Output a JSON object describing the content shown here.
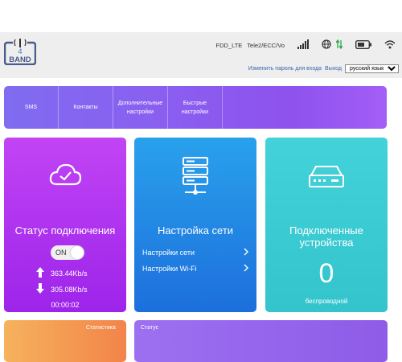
{
  "logo": {
    "text": "BAND",
    "digit": "4"
  },
  "status": {
    "network_type": "FDD_LTE",
    "operator": "Tele2/ECC/Vo",
    "icons": [
      "signal-icon",
      "globe-icon",
      "data-arrows-icon",
      "battery-icon",
      "wifi-icon"
    ]
  },
  "header_links": {
    "change_password": "Изменить пароль для входа",
    "logout": "Выход",
    "language": "русский язык"
  },
  "nav": {
    "items": [
      {
        "label": "SMS"
      },
      {
        "label": "Контакты"
      },
      {
        "label": "Дополнительные настройки"
      },
      {
        "label": "Быстрые настройки"
      }
    ]
  },
  "connection": {
    "title": "Статус подключения",
    "toggle": "ON",
    "upload_speed": "363.44Kb/s",
    "download_speed": "305.08Kb/s",
    "duration": "00:00:02"
  },
  "network": {
    "title": "Настройка сети",
    "links": [
      "Настройки сети",
      "Настройки Wi-Fi"
    ]
  },
  "devices": {
    "title": "Подключенные устройства",
    "count": "0",
    "label": "беспроводной"
  },
  "bottom": {
    "statistics": "Статистика",
    "state": "Статус"
  },
  "colors": {
    "status_card": "#b13cf0",
    "network_card": "#2488e4",
    "devices_card": "#3ccbd2",
    "nav_bar": "#8a5ff0",
    "stat_card": "#f4a055"
  }
}
